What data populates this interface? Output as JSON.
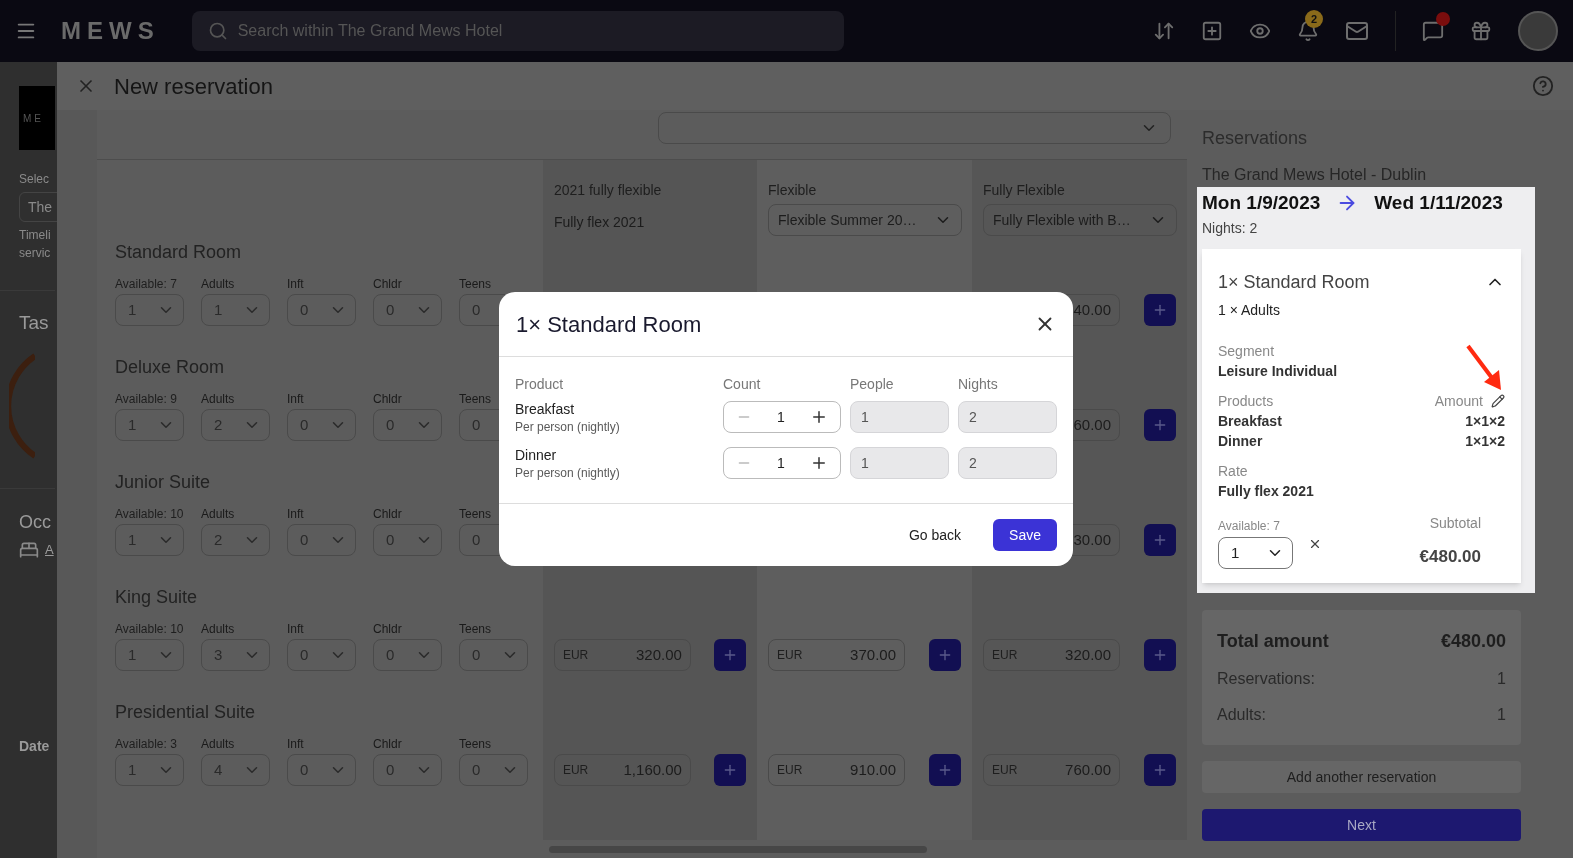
{
  "top_bar": {
    "logo": "MEWS",
    "search": {
      "placeholder": "Search within The Grand Mews Hotel"
    },
    "notifications_badge": "2",
    "help_alert": true
  },
  "background_page": {
    "logo": "ME",
    "select_label": "Selec",
    "select_value": "The",
    "note_lines": [
      "Timeli",
      "servic"
    ],
    "heading_1": "Tas",
    "heading_2": "Occ",
    "item": "A",
    "footer_label": "Date"
  },
  "panel": {
    "title": "New reservation"
  },
  "rate_columns": [
    {
      "heading": "2021 fully flexible",
      "rate": "Fully flex 2021",
      "kind": "text"
    },
    {
      "heading": "Flexible",
      "rate": "Flexible Summer 20…",
      "kind": "select"
    },
    {
      "heading": "Fully Flexible",
      "rate": "Fully Flexible with B…",
      "kind": "select"
    }
  ],
  "rooms": [
    {
      "name": "Standard Room",
      "available": "Available: 7",
      "count": "1",
      "fields": [
        {
          "label": "Adults",
          "value": "1"
        },
        {
          "label": "Inft",
          "value": "0"
        },
        {
          "label": "Chldr",
          "value": "0"
        },
        {
          "label": "Teens",
          "value": "0"
        }
      ],
      "prices": [
        {
          "amount": "40.00"
        }
      ]
    },
    {
      "name": "Deluxe Room",
      "available": "Available: 9",
      "count": "1",
      "fields": [
        {
          "label": "Adults",
          "value": "2"
        },
        {
          "label": "Inft",
          "value": "0"
        },
        {
          "label": "Chldr",
          "value": "0"
        },
        {
          "label": "Teens",
          "value": "0"
        }
      ],
      "prices": [
        {
          "amount": "60.00"
        }
      ]
    },
    {
      "name": "Junior Suite",
      "available": "Available: 10",
      "count": "1",
      "fields": [
        {
          "label": "Adults",
          "value": "2"
        },
        {
          "label": "Inft",
          "value": "0"
        },
        {
          "label": "Chldr",
          "value": "0"
        },
        {
          "label": "Teens",
          "value": "0"
        }
      ],
      "prices": [
        {
          "amount": "30.00"
        }
      ]
    },
    {
      "name": "King Suite",
      "available": "Available: 10",
      "count": "1",
      "fields": [
        {
          "label": "Adults",
          "value": "3"
        },
        {
          "label": "Inft",
          "value": "0"
        },
        {
          "label": "Chldr",
          "value": "0"
        },
        {
          "label": "Teens",
          "value": "0"
        }
      ],
      "prices": [
        {
          "currency": "EUR",
          "amount": "320.00"
        },
        {
          "currency": "EUR",
          "amount": "370.00"
        },
        {
          "currency": "EUR",
          "amount": "320.00"
        }
      ]
    },
    {
      "name": "Presidential Suite",
      "available": "Available: 3",
      "count": "1",
      "fields": [
        {
          "label": "Adults",
          "value": "4"
        },
        {
          "label": "Inft",
          "value": "0"
        },
        {
          "label": "Chldr",
          "value": "0"
        },
        {
          "label": "Teens",
          "value": "0"
        }
      ],
      "prices": [
        {
          "currency": "EUR",
          "amount": "1,160.00"
        },
        {
          "currency": "EUR",
          "amount": "910.00"
        },
        {
          "currency": "EUR",
          "amount": "760.00"
        }
      ]
    }
  ],
  "modal": {
    "title": "1× Standard Room",
    "columns": [
      "Product",
      "Count",
      "People",
      "Nights"
    ],
    "rows": [
      {
        "name": "Breakfast",
        "note": "Per person (nightly)",
        "count": "1",
        "people": "1",
        "nights": "2"
      },
      {
        "name": "Dinner",
        "note": "Per person (nightly)",
        "count": "1",
        "people": "1",
        "nights": "2"
      }
    ],
    "buttons": [
      {
        "label": "Go back",
        "kind": "text"
      },
      {
        "label": "Save",
        "kind": "primary"
      }
    ]
  },
  "sidebar": {
    "title": "Reservations",
    "hotel": "The Grand Mews Hotel - Dublin",
    "arrival": "Mon 1/9/2023",
    "departure": "Wed 1/11/2023",
    "nights": "Nights: 2",
    "reservation": {
      "title": "1× Standard Room",
      "guests": "1 × Adults",
      "expanded": true,
      "segment_label": "Segment",
      "segment": "Leisure Individual",
      "products_label": "Products",
      "amount_label": "Amount",
      "products": [
        {
          "name": "Breakfast",
          "amount": "1×1×2"
        },
        {
          "name": "Dinner",
          "amount": "1×1×2"
        }
      ],
      "rate_label": "Rate",
      "rate": "Fully flex 2021",
      "available": "Available: 7",
      "count": "1",
      "subtotal_label": "Subtotal",
      "subtotal": "€480.00"
    },
    "totals": {
      "title": "Total amount",
      "amount": "€480.00",
      "rows": [
        {
          "label": "Reservations:",
          "value": "1"
        },
        {
          "label": "Adults:",
          "value": "1"
        }
      ]
    },
    "buttons": [
      {
        "label": "Add another reservation",
        "kind": "secondary"
      },
      {
        "label": "Next",
        "kind": "primary"
      }
    ]
  }
}
